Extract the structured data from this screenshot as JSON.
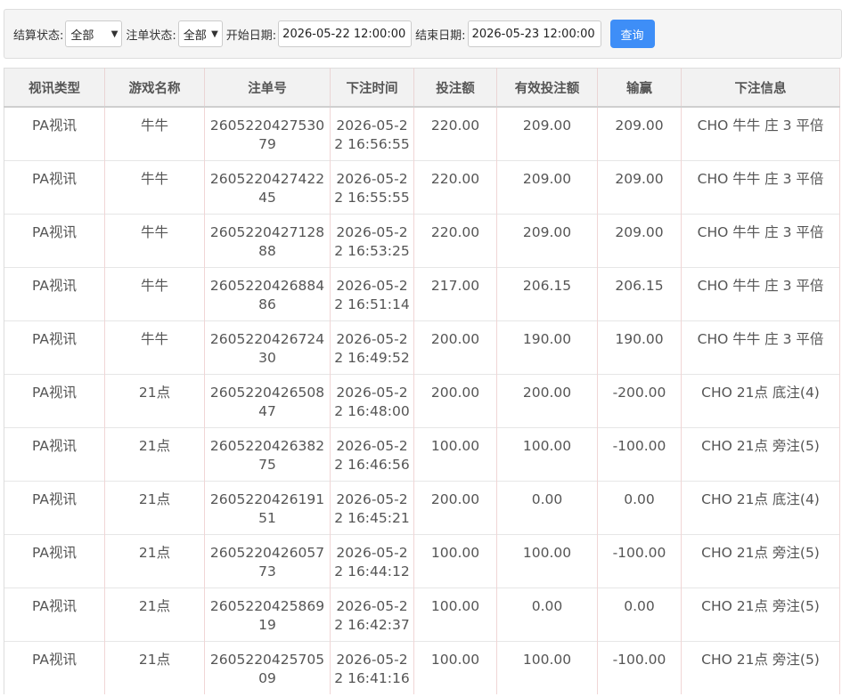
{
  "filters": {
    "settle_status_label": "结算状态:",
    "settle_status_value": "全部",
    "order_status_label": "注单状态:",
    "order_status_value": "全部",
    "start_date_label": "开始日期:",
    "start_date_value": "2026-05-22 12:00:00",
    "end_date_label": "结束日期:",
    "end_date_value": "2026-05-23 12:00:00",
    "query_button": "查询"
  },
  "table": {
    "headers": [
      "视讯类型",
      "游戏名称",
      "注单号",
      "下注时间",
      "投注额",
      "有效投注额",
      "输赢",
      "下注信息"
    ],
    "rows": [
      {
        "type": "PA视讯",
        "game": "牛牛",
        "order_no": "260522042753079",
        "bet_time": "2026-05-22 16:56:55",
        "bet": "220.00",
        "valid_bet": "209.00",
        "win_loss": "209.00",
        "info": "CHO 牛牛 庄 3 平倍"
      },
      {
        "type": "PA视讯",
        "game": "牛牛",
        "order_no": "260522042742245",
        "bet_time": "2026-05-22 16:55:55",
        "bet": "220.00",
        "valid_bet": "209.00",
        "win_loss": "209.00",
        "info": "CHO 牛牛 庄 3 平倍"
      },
      {
        "type": "PA视讯",
        "game": "牛牛",
        "order_no": "260522042712888",
        "bet_time": "2026-05-22 16:53:25",
        "bet": "220.00",
        "valid_bet": "209.00",
        "win_loss": "209.00",
        "info": "CHO 牛牛 庄 3 平倍"
      },
      {
        "type": "PA视讯",
        "game": "牛牛",
        "order_no": "260522042688486",
        "bet_time": "2026-05-22 16:51:14",
        "bet": "217.00",
        "valid_bet": "206.15",
        "win_loss": "206.15",
        "info": "CHO 牛牛 庄 3 平倍"
      },
      {
        "type": "PA视讯",
        "game": "牛牛",
        "order_no": "260522042672430",
        "bet_time": "2026-05-22 16:49:52",
        "bet": "200.00",
        "valid_bet": "190.00",
        "win_loss": "190.00",
        "info": "CHO 牛牛 庄 3 平倍"
      },
      {
        "type": "PA视讯",
        "game": "21点",
        "order_no": "260522042650847",
        "bet_time": "2026-05-22 16:48:00",
        "bet": "200.00",
        "valid_bet": "200.00",
        "win_loss": "-200.00",
        "info": "CHO 21点 底注(4)"
      },
      {
        "type": "PA视讯",
        "game": "21点",
        "order_no": "260522042638275",
        "bet_time": "2026-05-22 16:46:56",
        "bet": "100.00",
        "valid_bet": "100.00",
        "win_loss": "-100.00",
        "info": "CHO 21点 旁注(5)"
      },
      {
        "type": "PA视讯",
        "game": "21点",
        "order_no": "260522042619151",
        "bet_time": "2026-05-22 16:45:21",
        "bet": "200.00",
        "valid_bet": "0.00",
        "win_loss": "0.00",
        "info": "CHO 21点 底注(4)"
      },
      {
        "type": "PA视讯",
        "game": "21点",
        "order_no": "260522042605773",
        "bet_time": "2026-05-22 16:44:12",
        "bet": "100.00",
        "valid_bet": "100.00",
        "win_loss": "-100.00",
        "info": "CHO 21点 旁注(5)"
      },
      {
        "type": "PA视讯",
        "game": "21点",
        "order_no": "260522042586919",
        "bet_time": "2026-05-22 16:42:37",
        "bet": "100.00",
        "valid_bet": "0.00",
        "win_loss": "0.00",
        "info": "CHO 21点 旁注(5)"
      },
      {
        "type": "PA视讯",
        "game": "21点",
        "order_no": "260522042570509",
        "bet_time": "2026-05-22 16:41:16",
        "bet": "100.00",
        "valid_bet": "100.00",
        "win_loss": "-100.00",
        "info": "CHO 21点 旁注(5)"
      }
    ]
  }
}
